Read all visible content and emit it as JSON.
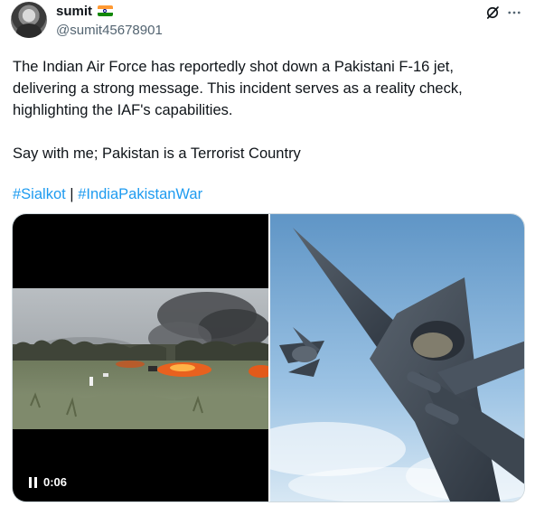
{
  "author": {
    "display_name": "sumit",
    "handle": "@sumit45678901",
    "flag": "india-flag-icon"
  },
  "header_icons": [
    "grok-icon",
    "more-icon"
  ],
  "tweet": {
    "line1": "The Indian Air Force has reportedly shot down a Pakistani F-16 jet,",
    "line2": "delivering a strong message. This incident serves as a reality check,",
    "line3": "highlighting the IAF's capabilities.",
    "line4": "Say with me; Pakistan is a Terrorist Country",
    "hashtag1": "#Sialkot",
    "separator": "|",
    "hashtag2": "#IndiaPakistanWar"
  },
  "media": {
    "video_duration": "0:06",
    "video_icon": "pause-icon"
  },
  "colors": {
    "link": "#1d9bf0",
    "secondary_text": "#536471",
    "primary_text": "#0f1419"
  }
}
